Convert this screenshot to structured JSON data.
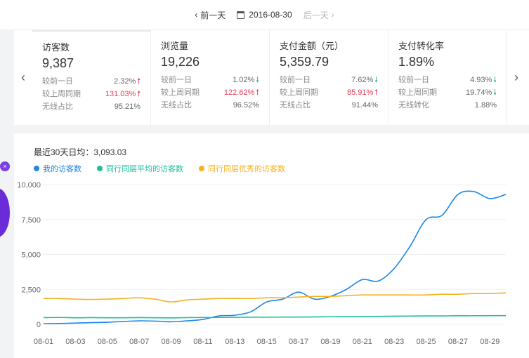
{
  "datebar": {
    "prev_label": "前一天",
    "date": "2016-08-30",
    "next_label": "后一天"
  },
  "cards": [
    {
      "title": "访客数",
      "value": "9,387",
      "rows": [
        {
          "label": "较前一日",
          "value": "2.32%",
          "dir": "up",
          "red": false
        },
        {
          "label": "较上周同期",
          "value": "131.03%",
          "dir": "up",
          "red": true
        },
        {
          "label": "无线占比",
          "value": "95.21%",
          "dir": "",
          "red": false
        }
      ]
    },
    {
      "title": "浏览量",
      "value": "19,226",
      "rows": [
        {
          "label": "较前一日",
          "value": "1.02%",
          "dir": "down",
          "red": false
        },
        {
          "label": "较上周同期",
          "value": "122.62%",
          "dir": "up",
          "red": true
        },
        {
          "label": "无线占比",
          "value": "96.52%",
          "dir": "",
          "red": false
        }
      ]
    },
    {
      "title": "支付金额（元）",
      "value": "5,359.79",
      "rows": [
        {
          "label": "较前一日",
          "value": "7.62%",
          "dir": "down",
          "red": false
        },
        {
          "label": "较上周同期",
          "value": "85.91%",
          "dir": "up",
          "red": true
        },
        {
          "label": "无线占比",
          "value": "91.44%",
          "dir": "",
          "red": false
        }
      ]
    },
    {
      "title": "支付转化率",
      "value": "1.89%",
      "rows": [
        {
          "label": "较前一日",
          "value": "4.93%",
          "dir": "down",
          "red": false
        },
        {
          "label": "较上周同期",
          "value": "19.74%",
          "dir": "down",
          "red": false
        },
        {
          "label": "无线转化",
          "value": "1.88%",
          "dir": "",
          "red": false
        }
      ]
    }
  ],
  "nav": {
    "left": "‹",
    "right": "›"
  },
  "chart": {
    "avg_label": "最近30天日均：3,093.03"
  },
  "badge": {
    "close": "×"
  },
  "colors": {
    "series1": "#1e88e5",
    "series2": "#1fbf9a",
    "series3": "#f5b21f"
  },
  "chart_data": {
    "type": "line",
    "x": [
      "08-01",
      "08-02",
      "08-03",
      "08-04",
      "08-05",
      "08-06",
      "08-07",
      "08-08",
      "08-09",
      "08-10",
      "08-11",
      "08-12",
      "08-13",
      "08-14",
      "08-15",
      "08-16",
      "08-17",
      "08-18",
      "08-19",
      "08-20",
      "08-21",
      "08-22",
      "08-23",
      "08-24",
      "08-25",
      "08-26",
      "08-27",
      "08-28",
      "08-29",
      "08-30"
    ],
    "xticks": [
      "08-01",
      "08-03",
      "08-05",
      "08-07",
      "08-09",
      "08-11",
      "08-13",
      "08-15",
      "08-17",
      "08-19",
      "08-21",
      "08-23",
      "08-25",
      "08-27",
      "08-29"
    ],
    "yticks": [
      "0",
      "2,500",
      "5,000",
      "7,500",
      "10,000"
    ],
    "ylim": [
      0,
      10000
    ],
    "series": [
      {
        "name": "我的访客数",
        "values": [
          50,
          60,
          90,
          120,
          150,
          200,
          250,
          230,
          180,
          250,
          350,
          600,
          650,
          900,
          1600,
          1800,
          2300,
          1800,
          2000,
          2500,
          3200,
          3100,
          4000,
          5600,
          7500,
          7800,
          9300,
          9500,
          9000,
          9300
        ]
      },
      {
        "name": "同行同层平均的访客数",
        "values": [
          480,
          490,
          470,
          480,
          470,
          470,
          480,
          470,
          460,
          480,
          490,
          490,
          500,
          510,
          510,
          520,
          520,
          530,
          540,
          550,
          560,
          570,
          580,
          590,
          600,
          600,
          610,
          610,
          620,
          620
        ]
      },
      {
        "name": "同行同层优秀的访客数",
        "values": [
          1850,
          1850,
          1800,
          1780,
          1800,
          1850,
          1900,
          1800,
          1600,
          1750,
          1800,
          1850,
          1850,
          1850,
          1900,
          1900,
          1950,
          2000,
          2000,
          2050,
          2100,
          2100,
          2100,
          2100,
          2100,
          2150,
          2150,
          2200,
          2200,
          2250
        ]
      }
    ]
  }
}
